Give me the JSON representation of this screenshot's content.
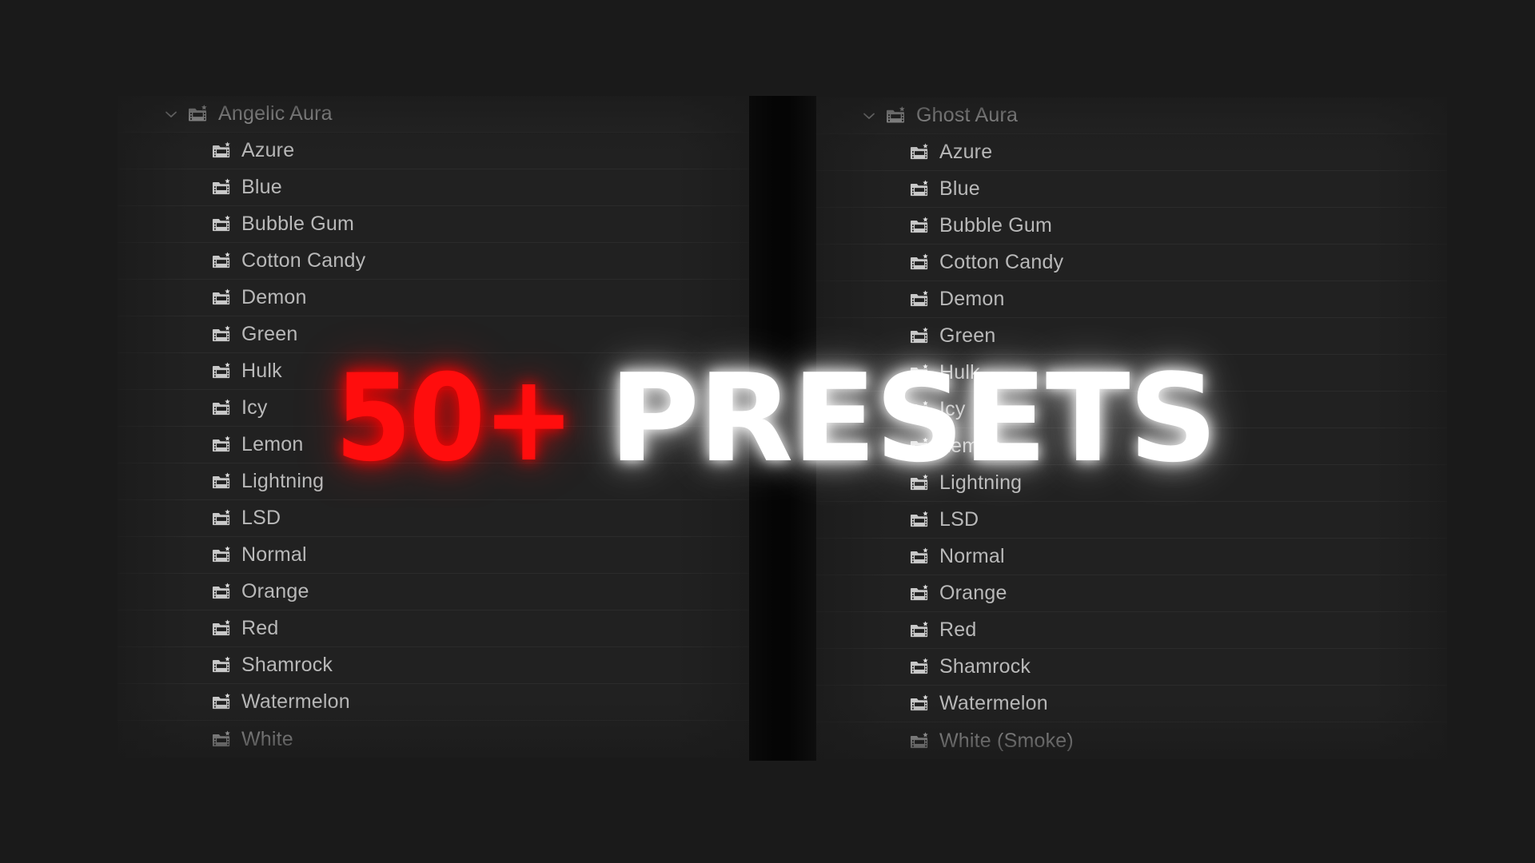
{
  "background_color": "#1a1a1a",
  "panel_color": "#212121",
  "row_separator_color": "#2b2b2b",
  "label_color": "#b9b9b9",
  "overlay": {
    "count_text": "50+",
    "count_color": "#ff0d0d",
    "word_text": "PRESETS",
    "word_color": "#ffffff"
  },
  "panels": [
    {
      "id": "angelic-aura",
      "header": {
        "label": "Angelic Aura",
        "expanded": true,
        "chevron_icon": "chevron-down-icon",
        "folder_icon": "folder-preset-star-icon"
      },
      "items": [
        {
          "label": "Azure",
          "icon": "folder-preset-star-icon"
        },
        {
          "label": "Blue",
          "icon": "folder-preset-star-icon"
        },
        {
          "label": "Bubble Gum",
          "icon": "folder-preset-star-icon"
        },
        {
          "label": "Cotton Candy",
          "icon": "folder-preset-star-icon"
        },
        {
          "label": "Demon",
          "icon": "folder-preset-star-icon"
        },
        {
          "label": "Green",
          "icon": "folder-preset-star-icon"
        },
        {
          "label": "Hulk",
          "icon": "folder-preset-star-icon"
        },
        {
          "label": "Icy",
          "icon": "folder-preset-star-icon"
        },
        {
          "label": "Lemon",
          "icon": "folder-preset-star-icon"
        },
        {
          "label": "Lightning",
          "icon": "folder-preset-star-icon"
        },
        {
          "label": "LSD",
          "icon": "folder-preset-star-icon"
        },
        {
          "label": "Normal",
          "icon": "folder-preset-star-icon"
        },
        {
          "label": "Orange",
          "icon": "folder-preset-star-icon"
        },
        {
          "label": "Red",
          "icon": "folder-preset-star-icon"
        },
        {
          "label": "Shamrock",
          "icon": "folder-preset-star-icon"
        },
        {
          "label": "Watermelon",
          "icon": "folder-preset-star-icon"
        },
        {
          "label": "White",
          "icon": "folder-preset-star-icon"
        }
      ]
    },
    {
      "id": "ghost-aura",
      "header": {
        "label": "Ghost Aura",
        "expanded": true,
        "chevron_icon": "chevron-down-icon",
        "folder_icon": "folder-preset-star-icon"
      },
      "items": [
        {
          "label": "Azure",
          "icon": "folder-preset-star-icon"
        },
        {
          "label": "Blue",
          "icon": "folder-preset-star-icon"
        },
        {
          "label": "Bubble Gum",
          "icon": "folder-preset-star-icon"
        },
        {
          "label": "Cotton Candy",
          "icon": "folder-preset-star-icon"
        },
        {
          "label": "Demon",
          "icon": "folder-preset-star-icon"
        },
        {
          "label": "Green",
          "icon": "folder-preset-star-icon"
        },
        {
          "label": "Hulk",
          "icon": "folder-preset-star-icon"
        },
        {
          "label": "Icy",
          "icon": "folder-preset-star-icon"
        },
        {
          "label": "Lemon",
          "icon": "folder-preset-star-icon"
        },
        {
          "label": "Lightning",
          "icon": "folder-preset-star-icon"
        },
        {
          "label": "LSD",
          "icon": "folder-preset-star-icon"
        },
        {
          "label": "Normal",
          "icon": "folder-preset-star-icon"
        },
        {
          "label": "Orange",
          "icon": "folder-preset-star-icon"
        },
        {
          "label": "Red",
          "icon": "folder-preset-star-icon"
        },
        {
          "label": "Shamrock",
          "icon": "folder-preset-star-icon"
        },
        {
          "label": "Watermelon",
          "icon": "folder-preset-star-icon"
        },
        {
          "label": "White (Smoke)",
          "icon": "folder-preset-star-icon"
        }
      ]
    }
  ]
}
